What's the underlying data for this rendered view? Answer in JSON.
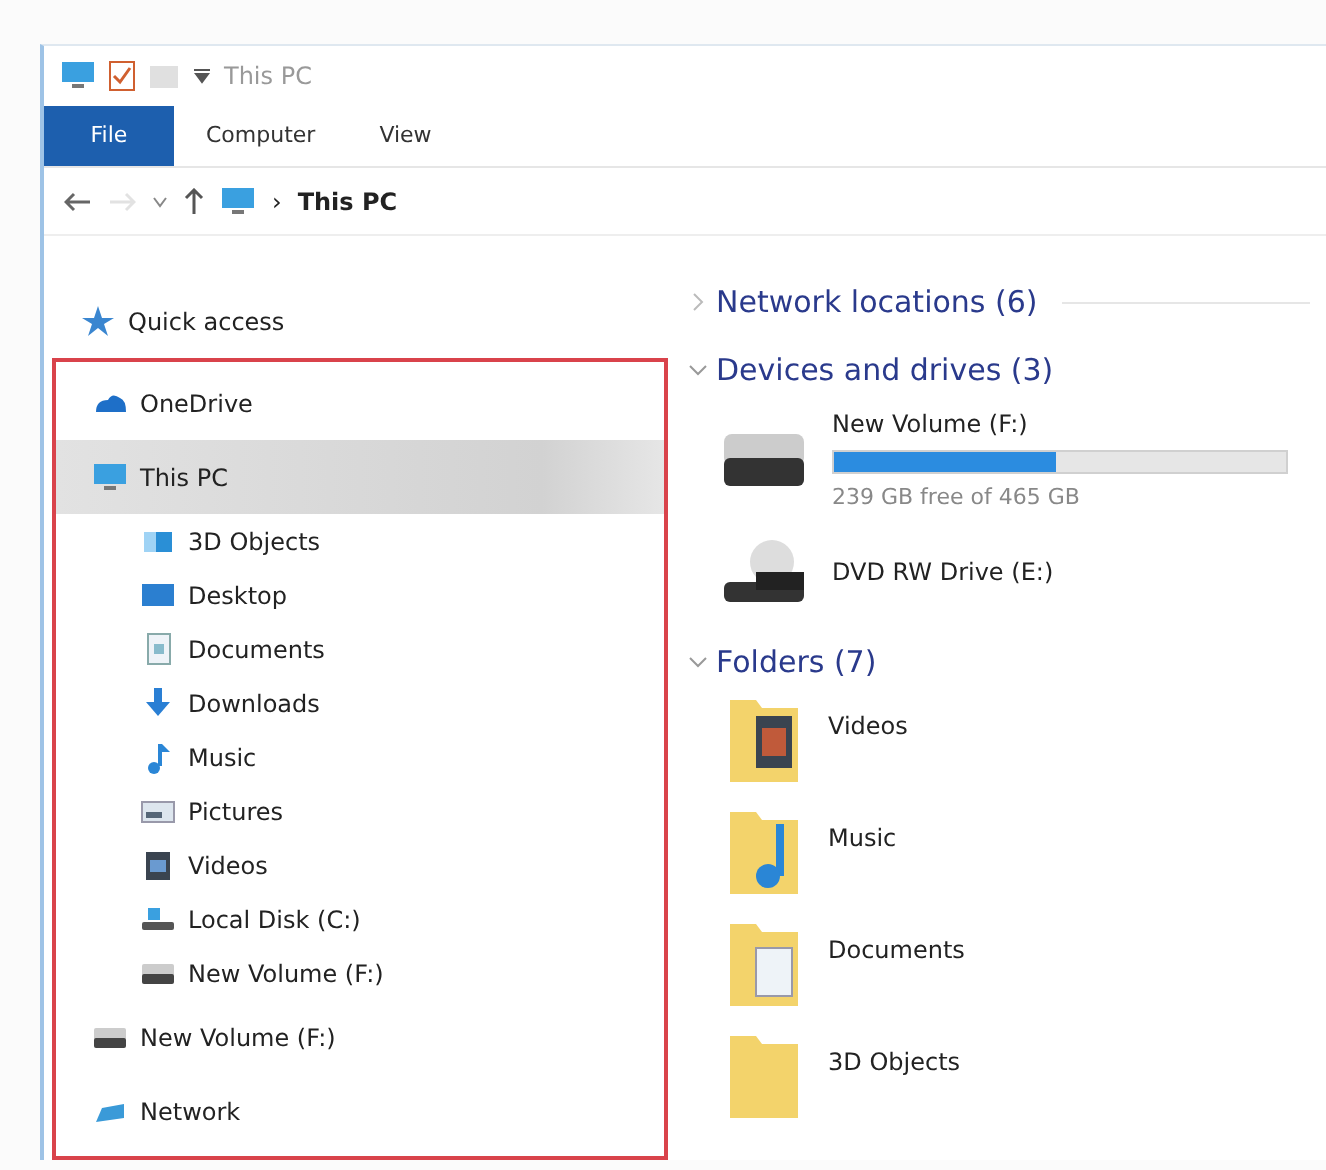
{
  "window": {
    "title": "This PC"
  },
  "ribbon_tabs": [
    {
      "label": "File",
      "kind": "file"
    },
    {
      "label": "Computer",
      "kind": "tab"
    },
    {
      "label": "View",
      "kind": "tab"
    }
  ],
  "address_bar": {
    "back_disabled": false,
    "forward_disabled": true,
    "separator": "›",
    "path": "This PC"
  },
  "sidebar": {
    "items": [
      {
        "label": "Quick access",
        "selected": false,
        "highlighted": false
      },
      {
        "label": "OneDrive",
        "selected": false,
        "highlighted": true
      },
      {
        "label": "This PC",
        "selected": true,
        "highlighted": true,
        "children": [
          {
            "label": "3D Objects",
            "selected": false
          },
          {
            "label": "Desktop",
            "selected": false
          },
          {
            "label": "Documents",
            "selected": false
          },
          {
            "label": "Downloads",
            "selected": false
          },
          {
            "label": "Music",
            "selected": false
          },
          {
            "label": "Pictures",
            "selected": false
          },
          {
            "label": "Videos",
            "selected": false
          },
          {
            "label": "Local Disk (C:)",
            "selected": false
          },
          {
            "label": "New Volume (F:)",
            "selected": false
          }
        ]
      },
      {
        "label": "New Volume (F:)",
        "selected": false,
        "highlighted": true
      },
      {
        "label": "Network",
        "selected": false,
        "highlighted": true
      }
    ]
  },
  "sections": [
    {
      "title": "Network locations (6)",
      "expanded": false
    },
    {
      "title": "Devices and drives (3)",
      "expanded": true,
      "drives": [
        {
          "kind": "disk",
          "name": "New Volume (F:)",
          "level": 0.49,
          "free_text": "239 GB free of 465 GB"
        },
        {
          "kind": "dvd",
          "name": "DVD RW Drive (E:)"
        }
      ]
    },
    {
      "title": "Folders (7)",
      "expanded": true,
      "folders": [
        {
          "name": "Videos"
        },
        {
          "name": "Music"
        },
        {
          "name": "Documents"
        },
        {
          "name": "3D Objects"
        }
      ]
    }
  ]
}
